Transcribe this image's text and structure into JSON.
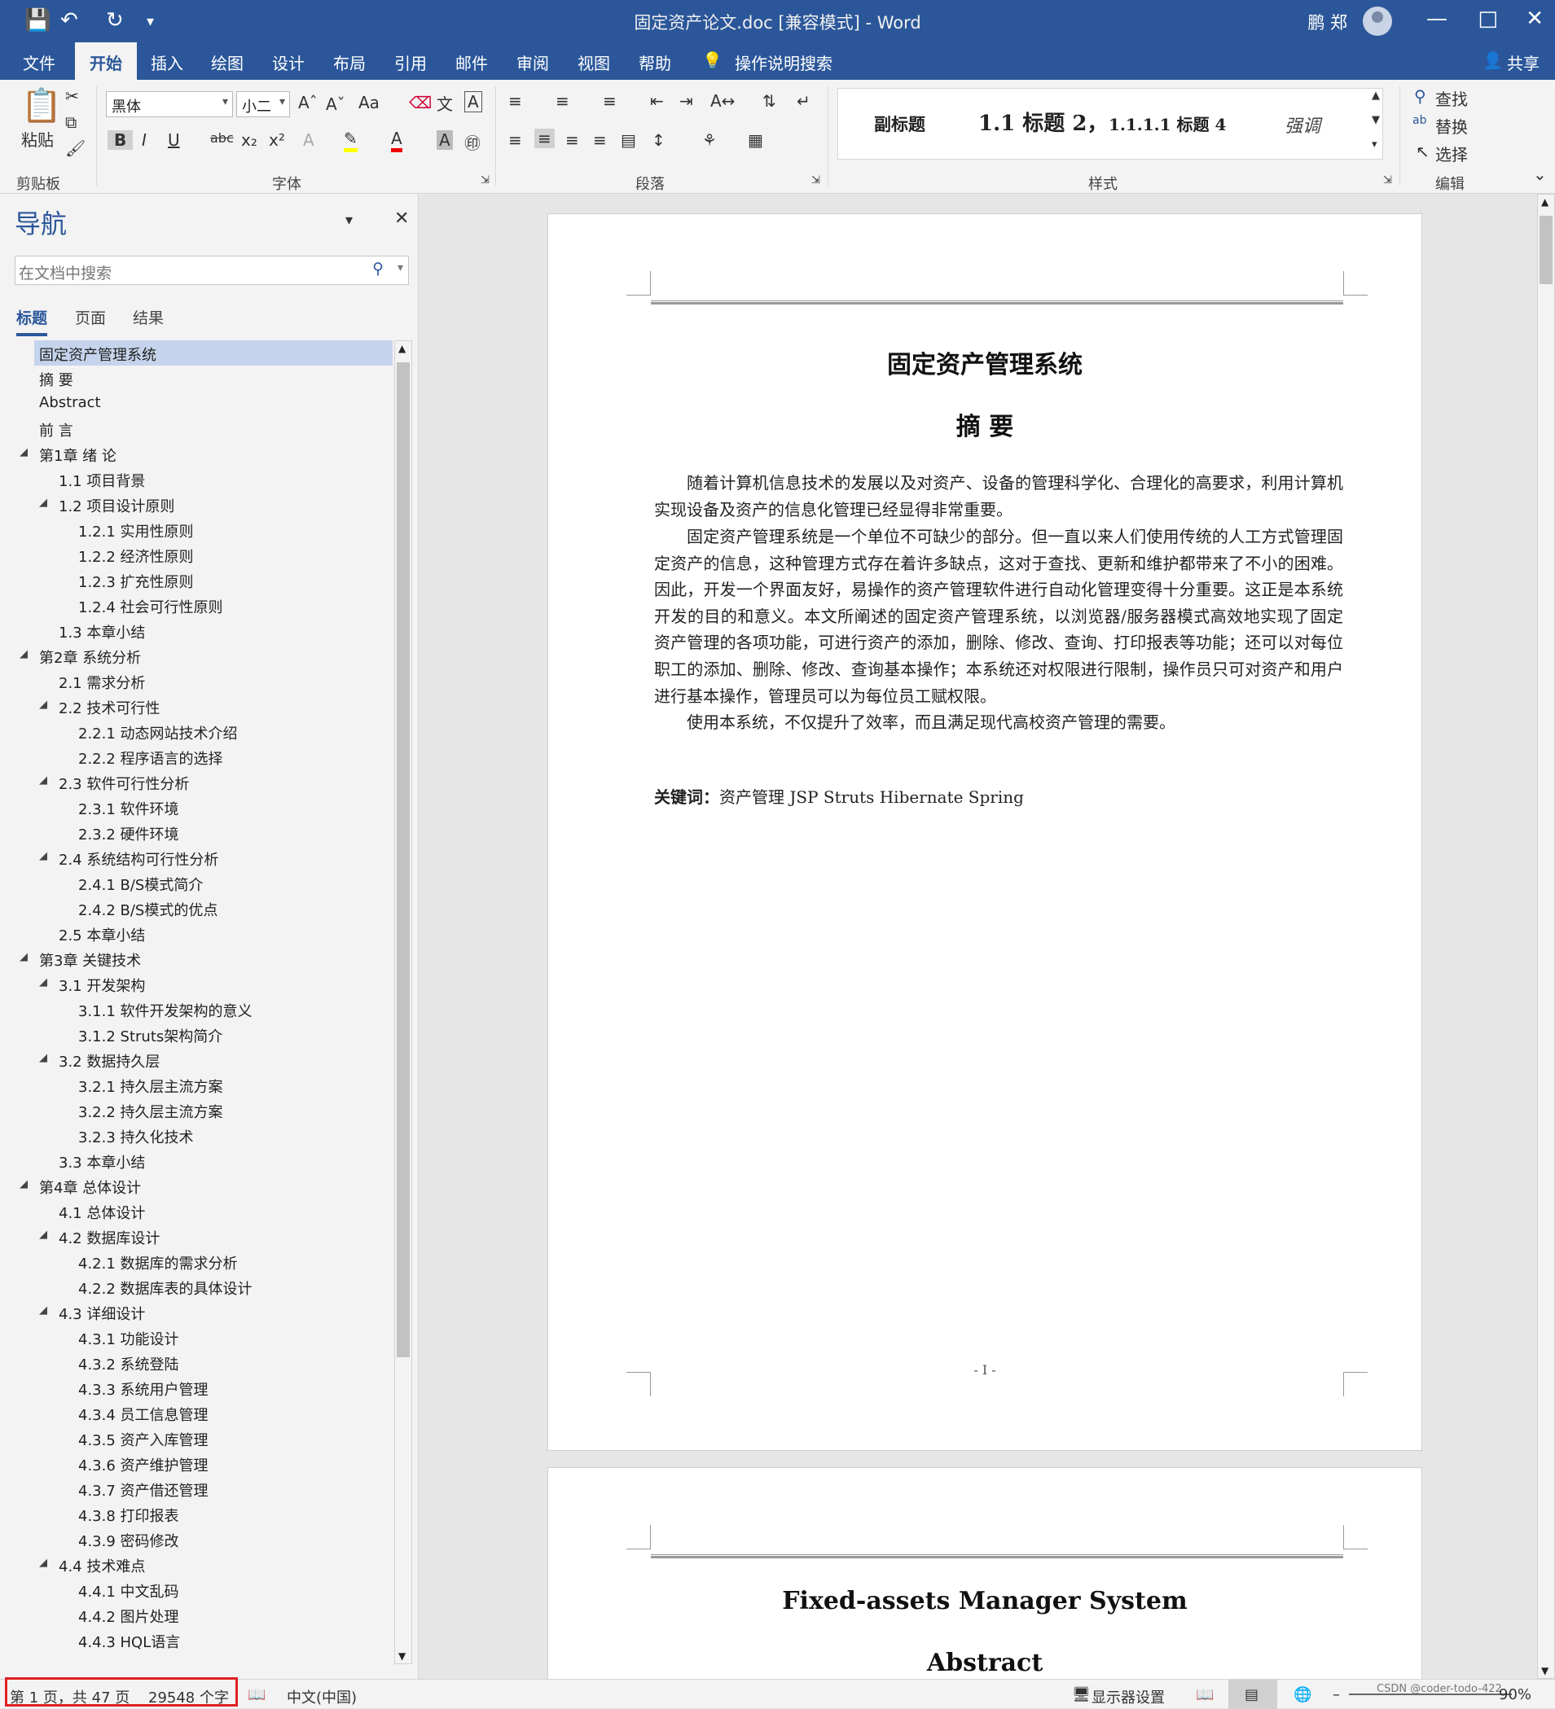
{
  "titlebar": {
    "doc_title": "固定资产论文.doc [兼容模式] - Word",
    "user": "鹏 郑",
    "save_icon": "save-icon",
    "undo_icon": "undo-icon",
    "redo_icon": "redo-icon"
  },
  "tabs": {
    "file": "文件",
    "home": "开始",
    "insert": "插入",
    "draw": "绘图",
    "design": "设计",
    "layout": "布局",
    "references": "引用",
    "mailings": "邮件",
    "review": "审阅",
    "view": "视图",
    "help": "帮助",
    "tellme": "操作说明搜索",
    "share": "共享"
  },
  "ribbon": {
    "paste": "粘贴",
    "clipboard_label": "剪贴板",
    "font_name": "黑体",
    "font_size": "小二",
    "font_label": "字体",
    "paragraph_label": "段落",
    "styles_label": "样式",
    "editing_label": "编辑",
    "find": "查找",
    "replace": "替换",
    "select": "选择",
    "styles": {
      "subtitle": "副标题",
      "heading2": "1.1  标题 2，",
      "heading4": "1.1.1.1  标题 4",
      "emphasis": "强调"
    }
  },
  "nav": {
    "title": "导航",
    "search_placeholder": "在文档中搜索",
    "tab_headings": "标题",
    "tab_pages": "页面",
    "tab_results": "结果",
    "items": [
      {
        "label": "固定资产管理系统",
        "level": 0,
        "expand": false,
        "selected": true
      },
      {
        "label": "摘  要",
        "level": 0,
        "expand": false
      },
      {
        "label": "Abstract",
        "level": 0,
        "expand": false
      },
      {
        "label": "前    言",
        "level": 0,
        "expand": false
      },
      {
        "label": "第1章  绪    论",
        "level": 0,
        "expand": true
      },
      {
        "label": "1.1 项目背景",
        "level": 1,
        "expand": false
      },
      {
        "label": "1.2 项目设计原则",
        "level": 1,
        "expand": true
      },
      {
        "label": "1.2.1 实用性原则",
        "level": 2,
        "expand": false
      },
      {
        "label": "1.2.2 经济性原则",
        "level": 2,
        "expand": false
      },
      {
        "label": "1.2.3 扩充性原则",
        "level": 2,
        "expand": false
      },
      {
        "label": "1.2.4 社会可行性原则",
        "level": 2,
        "expand": false
      },
      {
        "label": "1.3 本章小结",
        "level": 1,
        "expand": false
      },
      {
        "label": "第2章  系统分析",
        "level": 0,
        "expand": true
      },
      {
        "label": "2.1 需求分析",
        "level": 1,
        "expand": false
      },
      {
        "label": "2.2 技术可行性",
        "level": 1,
        "expand": true
      },
      {
        "label": "2.2.1 动态网站技术介绍",
        "level": 2,
        "expand": false
      },
      {
        "label": "2.2.2 程序语言的选择",
        "level": 2,
        "expand": false
      },
      {
        "label": "2.3 软件可行性分析",
        "level": 1,
        "expand": true
      },
      {
        "label": "2.3.1 软件环境",
        "level": 2,
        "expand": false
      },
      {
        "label": "2.3.2 硬件环境",
        "level": 2,
        "expand": false
      },
      {
        "label": "2.4 系统结构可行性分析",
        "level": 1,
        "expand": true
      },
      {
        "label": "2.4.1 B/S模式简介",
        "level": 2,
        "expand": false
      },
      {
        "label": "2.4.2 B/S模式的优点",
        "level": 2,
        "expand": false
      },
      {
        "label": "2.5 本章小结",
        "level": 1,
        "expand": false
      },
      {
        "label": "第3章  关键技术",
        "level": 0,
        "expand": true
      },
      {
        "label": "3.1 开发架构",
        "level": 1,
        "expand": true
      },
      {
        "label": "3.1.1 软件开发架构的意义",
        "level": 2,
        "expand": false
      },
      {
        "label": "3.1.2 Struts架构简介",
        "level": 2,
        "expand": false
      },
      {
        "label": "3.2 数据持久层",
        "level": 1,
        "expand": true
      },
      {
        "label": "3.2.1 持久层主流方案",
        "level": 2,
        "expand": false
      },
      {
        "label": "3.2.2 持久层主流方案",
        "level": 2,
        "expand": false
      },
      {
        "label": "3.2.3 持久化技术",
        "level": 2,
        "expand": false
      },
      {
        "label": "3.3 本章小结",
        "level": 1,
        "expand": false
      },
      {
        "label": "第4章  总体设计",
        "level": 0,
        "expand": true
      },
      {
        "label": "4.1 总体设计",
        "level": 1,
        "expand": false
      },
      {
        "label": "4.2 数据库设计",
        "level": 1,
        "expand": true
      },
      {
        "label": "4.2.1 数据库的需求分析",
        "level": 2,
        "expand": false
      },
      {
        "label": "4.2.2 数据库表的具体设计",
        "level": 2,
        "expand": false
      },
      {
        "label": "4.3 详细设计",
        "level": 1,
        "expand": true
      },
      {
        "label": "4.3.1 功能设计",
        "level": 2,
        "expand": false
      },
      {
        "label": "4.3.2 系统登陆",
        "level": 2,
        "expand": false
      },
      {
        "label": "4.3.3 系统用户管理",
        "level": 2,
        "expand": false
      },
      {
        "label": "4.3.4 员工信息管理",
        "level": 2,
        "expand": false
      },
      {
        "label": "4.3.5 资产入库管理",
        "level": 2,
        "expand": false
      },
      {
        "label": "4.3.6 资产维护管理",
        "level": 2,
        "expand": false
      },
      {
        "label": "4.3.7 资产借还管理",
        "level": 2,
        "expand": false
      },
      {
        "label": "4.3.8 打印报表",
        "level": 2,
        "expand": false
      },
      {
        "label": "4.3.9 密码修改",
        "level": 2,
        "expand": false
      },
      {
        "label": "4.4 技术难点",
        "level": 1,
        "expand": true
      },
      {
        "label": "4.4.1 中文乱码",
        "level": 2,
        "expand": false
      },
      {
        "label": "4.4.2 图片处理",
        "level": 2,
        "expand": false
      },
      {
        "label": "4.4.3 HQL语言",
        "level": 2,
        "expand": false
      }
    ]
  },
  "page1": {
    "title": "固定资产管理系统",
    "abstract_heading": "摘    要",
    "paragraphs": [
      "随着计算机信息技术的发展以及对资产、设备的管理科学化、合理化的高要求，利用计算机实现设备及资产的信息化管理已经显得非常重要。",
      "固定资产管理系统是一个单位不可缺少的部分。但一直以来人们使用传统的人工方式管理固定资产的信息，这种管理方式存在着许多缺点，这对于查找、更新和维护都带来了不小的困难。因此，开发一个界面友好，易操作的资产管理软件进行自动化管理变得十分重要。这正是本系统开发的目的和意义。本文所阐述的固定资产管理系统，以浏览器/服务器模式高效地实现了固定资产管理的各项功能，可进行资产的添加，删除、修改、查询、打印报表等功能；还可以对每位职工的添加、删除、修改、查询基本操作；本系统还对权限进行限制，操作员只可对资产和用户进行基本操作，管理员可以为每位员工赋权限。",
      "使用本系统，不仅提升了效率，而且满足现代高校资产管理的需要。"
    ],
    "keywords_label": "关键词：",
    "keywords": "资产管理  JSP Struts Hibernate Spring",
    "page_number": "- I -"
  },
  "page2": {
    "title": "Fixed-assets Manager System",
    "abstract_heading": "Abstract"
  },
  "status": {
    "pages": "第 1 页，共 47 页",
    "words": "29548 个字",
    "language": "中文(中国)",
    "display_settings": "显示器设置",
    "zoom": "90%",
    "watermark": "CSDN @coder-todo-422"
  },
  "colors": {
    "accent": "#2b579a",
    "highlight_box": "#e02020"
  }
}
